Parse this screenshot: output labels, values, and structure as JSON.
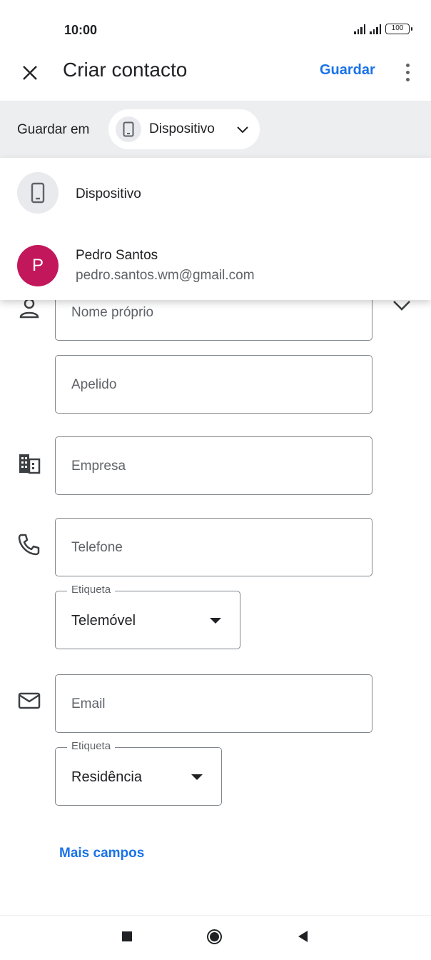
{
  "status_bar": {
    "time": "10:00",
    "battery": "100"
  },
  "app_bar": {
    "title": "Criar contacto",
    "save_label": "Guardar",
    "close_icon": "close-icon",
    "more_icon": "more-vert-icon"
  },
  "save_in": {
    "label": "Guardar em",
    "selected": "Dispositivo"
  },
  "account_menu": {
    "items": [
      {
        "label": "Dispositivo",
        "icon": "phone-icon"
      },
      {
        "label": "Pedro Santos",
        "sublabel": "pedro.santos.wm@gmail.com",
        "avatar_letter": "P",
        "avatar_color": "#c2185b"
      }
    ]
  },
  "form": {
    "first_name_placeholder": "Nome próprio",
    "last_name_placeholder": "Apelido",
    "company_placeholder": "Empresa",
    "phone_placeholder": "Telefone",
    "phone_label_caption": "Etiqueta",
    "phone_label_value": "Telemóvel",
    "email_placeholder": "Email",
    "email_label_caption": "Etiqueta",
    "email_label_value": "Residência",
    "more_fields": "Mais campos"
  },
  "colors": {
    "accent": "#1a73e8",
    "chip_bar": "#edeef0"
  }
}
